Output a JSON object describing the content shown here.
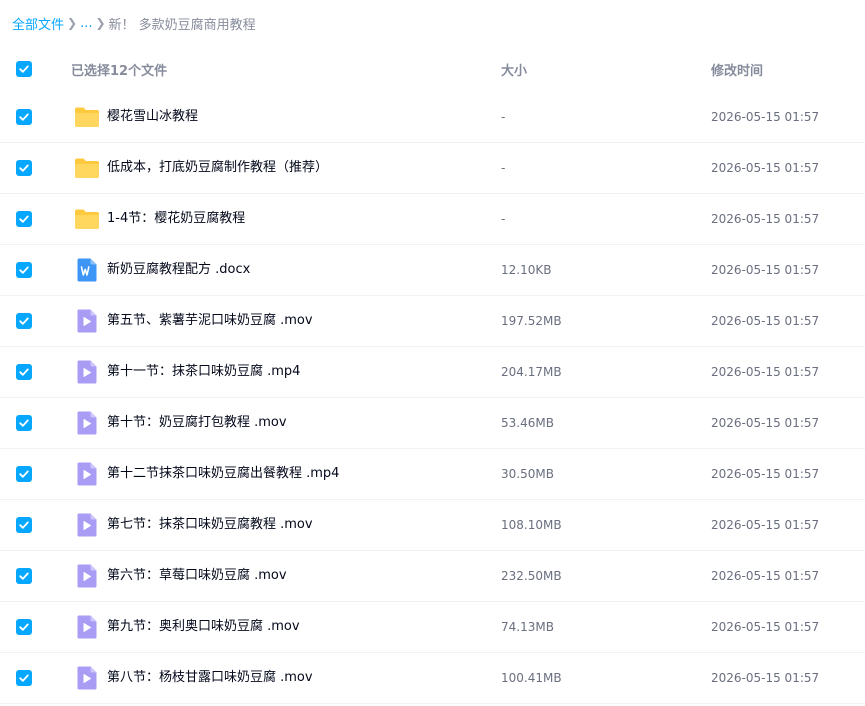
{
  "breadcrumb": {
    "root": "全部文件",
    "ellipsis": "...",
    "current": "新！ 多款奶豆腐商用教程"
  },
  "header": {
    "selected_count": "已选择12个文件",
    "size_label": "大小",
    "time_label": "修改时间"
  },
  "colors": {
    "accent": "#06a7ff",
    "folder": "#ffc93f",
    "video": "#a99cf5",
    "doc": "#3d95f5"
  },
  "files": [
    {
      "name": "樱花雪山冰教程",
      "size": "-",
      "time": "2026-05-15 01:57",
      "type": "folder",
      "icon": "folder-icon",
      "checked": true
    },
    {
      "name": "低成本，打底奶豆腐制作教程（推荐）",
      "size": "-",
      "time": "2026-05-15 01:57",
      "type": "folder",
      "icon": "folder-icon",
      "checked": true
    },
    {
      "name": "1-4节：樱花奶豆腐教程",
      "size": "-",
      "time": "2026-05-15 01:57",
      "type": "folder",
      "icon": "folder-icon",
      "checked": true
    },
    {
      "name": "新奶豆腐教程配方 .docx",
      "size": "12.10KB",
      "time": "2026-05-15 01:57",
      "type": "doc",
      "icon": "word-doc-icon",
      "checked": true
    },
    {
      "name": "第五节、紫薯芋泥口味奶豆腐 .mov",
      "size": "197.52MB",
      "time": "2026-05-15 01:57",
      "type": "video",
      "icon": "video-file-icon",
      "checked": true
    },
    {
      "name": "第十一节：抹茶口味奶豆腐 .mp4",
      "size": "204.17MB",
      "time": "2026-05-15 01:57",
      "type": "video",
      "icon": "video-file-icon",
      "checked": true
    },
    {
      "name": "第十节：奶豆腐打包教程 .mov",
      "size": "53.46MB",
      "time": "2026-05-15 01:57",
      "type": "video",
      "icon": "video-file-icon",
      "checked": true
    },
    {
      "name": "第十二节抹茶口味奶豆腐出餐教程 .mp4",
      "size": "30.50MB",
      "time": "2026-05-15 01:57",
      "type": "video",
      "icon": "video-file-icon",
      "checked": true
    },
    {
      "name": "第七节：抹茶口味奶豆腐教程 .mov",
      "size": "108.10MB",
      "time": "2026-05-15 01:57",
      "type": "video",
      "icon": "video-file-icon",
      "checked": true
    },
    {
      "name": "第六节：草莓口味奶豆腐 .mov",
      "size": "232.50MB",
      "time": "2026-05-15 01:57",
      "type": "video",
      "icon": "video-file-icon",
      "checked": true
    },
    {
      "name": "第九节：奥利奥口味奶豆腐 .mov",
      "size": "74.13MB",
      "time": "2026-05-15 01:57",
      "type": "video",
      "icon": "video-file-icon",
      "checked": true
    },
    {
      "name": "第八节：杨枝甘露口味奶豆腐 .mov",
      "size": "100.41MB",
      "time": "2026-05-15 01:57",
      "type": "video",
      "icon": "video-file-icon",
      "checked": true
    }
  ]
}
